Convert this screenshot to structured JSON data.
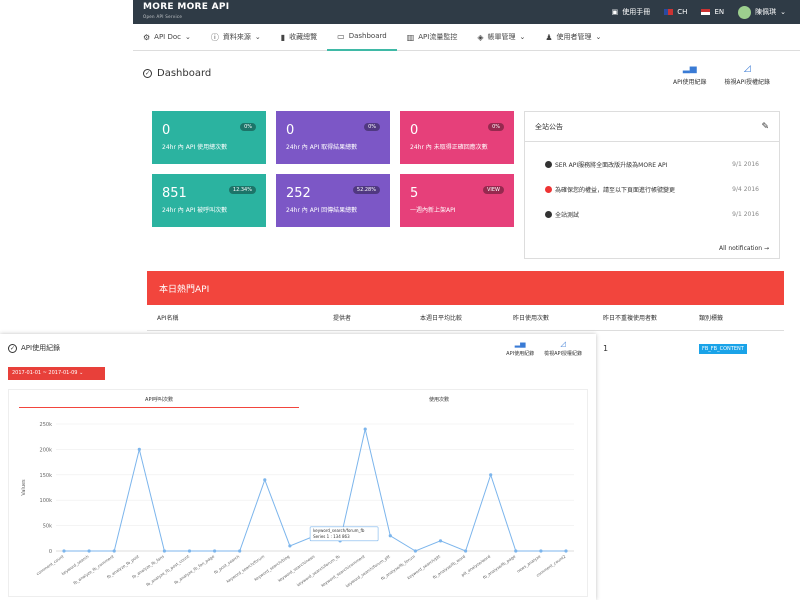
{
  "brand": {
    "name": "MORE MORE API",
    "sub": "Open API Service"
  },
  "topbar": {
    "manual": "使用手冊",
    "lang_ch": "CH",
    "lang_en": "EN",
    "user": "陳佩琪"
  },
  "menu": [
    "API Doc",
    "資料來源",
    "收藏總覽",
    "Dashboard",
    "API流量監控",
    "帳單管理",
    "使用者管理"
  ],
  "page_title": "Dashboard",
  "header_actions": [
    "API使用紀錄",
    "檢視API授權紀錄"
  ],
  "cards": [
    {
      "num": "0",
      "label": "24hr 內 API 使用總次數",
      "badge": "0%"
    },
    {
      "num": "0",
      "label": "24hr 內 API 取得結果總數",
      "badge": "0%"
    },
    {
      "num": "0",
      "label": "24hr 內 未取得正確回應次數",
      "badge": "0%"
    },
    {
      "num": "851",
      "label": "24hr 內 API 被呼叫次數",
      "badge": "12.34%"
    },
    {
      "num": "252",
      "label": "24hr 內 API 回傳結果總數",
      "badge": "52.28%"
    },
    {
      "num": "5",
      "label": "一週內新上架API",
      "badge": "VIEW"
    }
  ],
  "announce": {
    "title": "全站公告",
    "items": [
      {
        "text": "SER API服務將全面改版升級為MORE API",
        "date": "9/1 2016"
      },
      {
        "text": "為確保您的權益，請至以下頁面進行帳號變更",
        "date": "9/4 2016"
      },
      {
        "text": "全站測試",
        "date": "9/1 2016"
      }
    ],
    "all": "All notification →"
  },
  "hot": {
    "title": "本日熱門API",
    "cols": [
      "API名稱",
      "提供者",
      "本週日平均比較",
      "昨日使用次數",
      "昨日不重複使用者數",
      "類別標籤"
    ],
    "value": "1",
    "tag": "FB_FB_CONTENT"
  },
  "overlay": {
    "title": "API使用紀錄",
    "daterange": "2017-01-01 ~ 2017-01-09 ⌄",
    "actions": [
      "API使用紀錄",
      "檢視API授權紀錄"
    ],
    "tabs": [
      "API呼叫次數",
      "使用次數"
    ],
    "tooltip": {
      "title": "keyword_search/forum_fb",
      "value": "Series 1 : 134 863"
    }
  },
  "chart_data": {
    "type": "line",
    "ylabel": "Values",
    "yticks": [
      "0",
      "50k",
      "100k",
      "150k",
      "200k",
      "250k"
    ],
    "ylim": [
      0,
      250000
    ],
    "x": [
      "comment_count",
      "keyword_search",
      "fb_analyze_fb_comment",
      "fb_analyze_fb_post",
      "fb_analyze_fb_fans",
      "fb_analyze_fb_post_count",
      "fb_analyze_fb_fan_page",
      "fb_post_search",
      "keyword_search/forum",
      "keyword_search/blog",
      "keyword_search/news",
      "keyword_search/forum_fb",
      "keyword_search/comment",
      "keyword_search/forum_ptt",
      "fb_analyze/fb_forum",
      "keyword_search/ptt",
      "fb_analyze/fb_word",
      "ptt_analyze/word",
      "fb_analyze/fb_page",
      "news_analyze",
      "comment_count2"
    ],
    "values": [
      0,
      0,
      0,
      200000,
      0,
      0,
      0,
      0,
      140000,
      10000,
      30000,
      20000,
      240000,
      30000,
      0,
      20000,
      0,
      150000,
      0,
      0,
      0
    ]
  }
}
